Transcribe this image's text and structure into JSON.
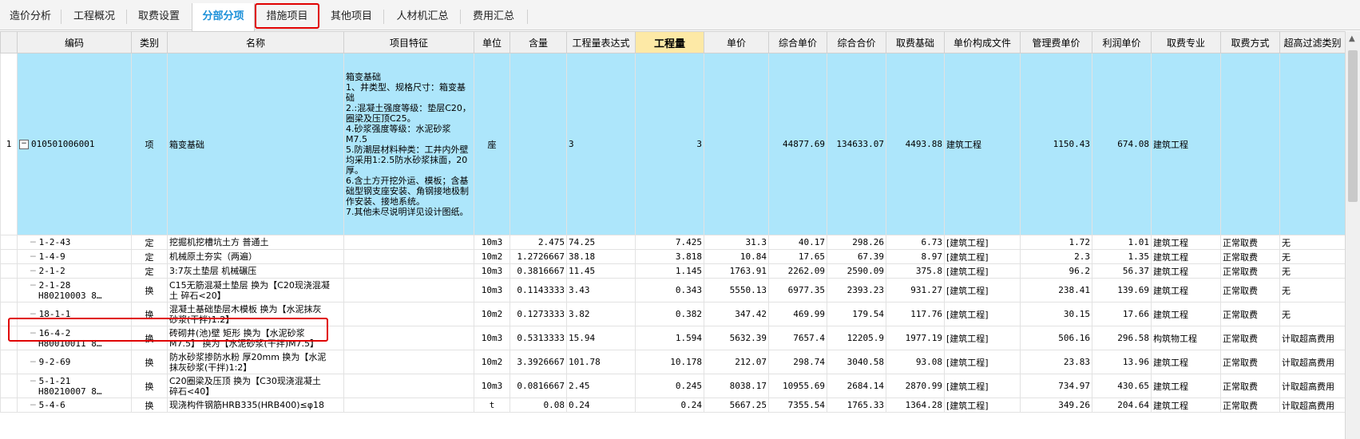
{
  "tabs": [
    {
      "label": "造价分析"
    },
    {
      "label": "工程概况"
    },
    {
      "label": "取费设置"
    },
    {
      "label": "分部分项",
      "active": true
    },
    {
      "label": "措施项目",
      "highlighted": true
    },
    {
      "label": "其他项目"
    },
    {
      "label": "人材机汇总"
    },
    {
      "label": "费用汇总"
    }
  ],
  "columns": [
    "编码",
    "类别",
    "名称",
    "项目特征",
    "单位",
    "含量",
    "工程量表达式",
    "工程量",
    "单价",
    "综合单价",
    "综合合价",
    "取费基础",
    "单价构成文件",
    "管理费单价",
    "利润单价",
    "取费专业",
    "取费方式",
    "超高过滤类别"
  ],
  "main_row": {
    "num": "1",
    "code": "010501006001",
    "type": "项",
    "name": "箱变基础",
    "feature": [
      "箱变基础",
      "1、井类型、规格尺寸：箱变基础",
      "2.:混凝土强度等级：垫层C20，圈梁及压顶C25。",
      "4.砂浆强度等级：水泥砂浆M7.5",
      "5.防潮层材料种类：工井内外壁均采用1:2.5防水砂浆抹面，20厚。",
      "6.含土方开挖外运、模板；含基础型钢支座安装、角钢接地极制作安装、接地系统。",
      "7.其他未尽说明详见设计图纸。"
    ],
    "unit": "座",
    "qty_expr": "3",
    "qty": "3",
    "unit_total": "44877.69",
    "total": "134633.07",
    "base": "4493.88",
    "file": "建筑工程",
    "mgmt": "1150.43",
    "profit": "674.08",
    "specialty": "建筑工程"
  },
  "sub_rows": [
    {
      "code": [
        "1-2-43"
      ],
      "type": "定",
      "name": [
        "挖掘机挖槽坑土方 普通土"
      ],
      "unit": "10m3",
      "content": "2.475",
      "expr": "74.25",
      "qty": "7.425",
      "price": "31.3",
      "unit_total": "40.17",
      "total": "298.26",
      "base": "6.73",
      "file": "[建筑工程]",
      "mgmt": "1.72",
      "profit": "1.01",
      "specialty": "建筑工程",
      "mode": "正常取费",
      "filter": "无"
    },
    {
      "code": [
        "1-4-9"
      ],
      "type": "定",
      "name": [
        "机械原土夯实（两遍）"
      ],
      "unit": "10m2",
      "content": "1.2726667",
      "expr": "38.18",
      "qty": "3.818",
      "price": "10.84",
      "unit_total": "17.65",
      "total": "67.39",
      "base": "8.97",
      "file": "[建筑工程]",
      "mgmt": "2.3",
      "profit": "1.35",
      "specialty": "建筑工程",
      "mode": "正常取费",
      "filter": "无"
    },
    {
      "code": [
        "2-1-2"
      ],
      "type": "定",
      "name": [
        "3:7灰土垫层 机械碾压"
      ],
      "unit": "10m3",
      "content": "0.3816667",
      "expr": "11.45",
      "qty": "1.145",
      "price": "1763.91",
      "unit_total": "2262.09",
      "total": "2590.09",
      "base": "375.8",
      "file": "[建筑工程]",
      "mgmt": "96.2",
      "profit": "56.37",
      "specialty": "建筑工程",
      "mode": "正常取费",
      "filter": "无"
    },
    {
      "code": [
        "2-1-28",
        "H80210003 8…"
      ],
      "type": "换",
      "name": [
        "C15无筋混凝土垫层  换为【C20现浇混凝",
        "土 碎石<20】"
      ],
      "unit": "10m3",
      "content": "0.1143333",
      "expr": "3.43",
      "qty": "0.343",
      "price": "5550.13",
      "unit_total": "6977.35",
      "total": "2393.23",
      "base": "931.27",
      "file": "[建筑工程]",
      "mgmt": "238.41",
      "profit": "139.69",
      "specialty": "建筑工程",
      "mode": "正常取费",
      "filter": "无"
    },
    {
      "code": [
        "18-1-1"
      ],
      "type": "换",
      "name": [
        "混凝土基础垫层木模板  换为【水泥抹灰",
        "砂浆(干拌)1:2】"
      ],
      "unit": "10m2",
      "content": "0.1273333",
      "expr": "3.82",
      "qty": "0.382",
      "price": "347.42",
      "unit_total": "469.99",
      "total": "179.54",
      "base": "117.76",
      "file": "[建筑工程]",
      "mgmt": "30.15",
      "profit": "17.66",
      "specialty": "建筑工程",
      "mode": "正常取费",
      "filter": "无"
    },
    {
      "code": [
        "16-4-2",
        "H80010011 8…"
      ],
      "type": "换",
      "name": [
        "砖砌井(池)壁 矩形  换为【水泥砂浆",
        "M7.5】 换为【水泥砂浆(干拌)M7.5】"
      ],
      "unit": "10m3",
      "content": "0.5313333",
      "expr": "15.94",
      "qty": "1.594",
      "price": "5632.39",
      "unit_total": "7657.4",
      "total": "12205.9",
      "base": "1977.19",
      "file": "[建筑工程]",
      "mgmt": "506.16",
      "profit": "296.58",
      "specialty": "构筑物工程",
      "mode": "正常取费",
      "filter": "计取超高费用"
    },
    {
      "code": [
        "9-2-69"
      ],
      "type": "换",
      "name": [
        "防水砂浆掺防水粉 厚20mm  换为【水泥",
        "抹灰砂浆(干拌)1:2】"
      ],
      "unit": "10m2",
      "content": "3.3926667",
      "expr": "101.78",
      "qty": "10.178",
      "price": "212.07",
      "unit_total": "298.74",
      "total": "3040.58",
      "base": "93.08",
      "file": "[建筑工程]",
      "mgmt": "23.83",
      "profit": "13.96",
      "specialty": "建筑工程",
      "mode": "正常取费",
      "filter": "计取超高费用"
    },
    {
      "code": [
        "5-1-21",
        "H80210007 8…"
      ],
      "type": "换",
      "name": [
        "C20圈梁及压顶  换为【C30现浇混凝土",
        "碎石<40】"
      ],
      "unit": "10m3",
      "content": "0.0816667",
      "expr": "2.45",
      "qty": "0.245",
      "price": "8038.17",
      "unit_total": "10955.69",
      "total": "2684.14",
      "base": "2870.99",
      "file": "[建筑工程]",
      "mgmt": "734.97",
      "profit": "430.65",
      "specialty": "建筑工程",
      "mode": "正常取费",
      "filter": "计取超高费用"
    },
    {
      "code": [
        "5-4-6"
      ],
      "type": "换",
      "name": [
        "现浇构件钢筋HRB335(HRB400)≤φ18"
      ],
      "unit": "t",
      "content": "0.08",
      "expr": "0.24",
      "qty": "0.24",
      "price": "5667.25",
      "unit_total": "7355.54",
      "total": "1765.33",
      "base": "1364.28",
      "file": "[建筑工程]",
      "mgmt": "349.26",
      "profit": "204.64",
      "specialty": "建筑工程",
      "mode": "正常取费",
      "filter": "计取超高费用"
    }
  ]
}
